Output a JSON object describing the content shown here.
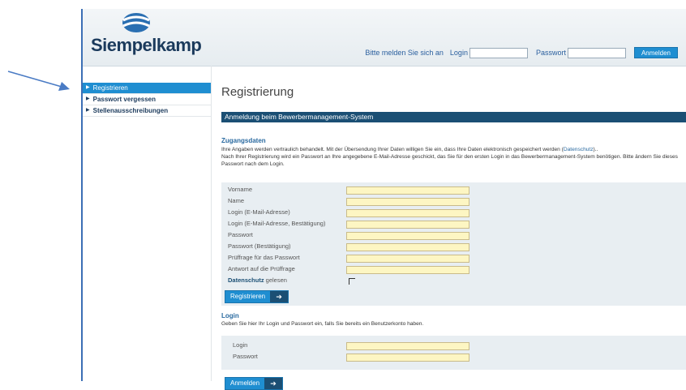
{
  "header": {
    "logo_text": "Siempelkamp",
    "login_prompt": "Bitte melden Sie sich an",
    "login_label": "Login",
    "password_label": "Passwort",
    "submit_label": "Anmelden"
  },
  "sidebar": {
    "items": [
      {
        "label": "Registrieren",
        "active": true
      },
      {
        "label": "Passwort vergessen",
        "active": false
      },
      {
        "label": "Stellenausschreibungen",
        "active": false
      }
    ]
  },
  "main": {
    "title": "Registrierung",
    "section_bar": "Anmeldung beim Bewerbermanagement-System",
    "access_heading": "Zugangsdaten",
    "intro_line1": "Ihre Angaben werden vertraulich behandelt. Mit der Übersendung Ihrer Daten willigen Sie ein, dass Ihre Daten elektronisch gespeichert werden (",
    "intro_link": "Datenschutz",
    "intro_line1_end": ")..",
    "intro_line2": "Nach Ihrer Registrierung wird ein Passwort an Ihre angegebene E-Mail-Adresse geschickt, das Sie für den ersten Login in das Bewerbermanagement-System benötigen. Bitte ändern Sie dieses Passwort nach dem Login.",
    "form": {
      "fields": [
        "Vorname",
        "Name",
        "Login (E-Mail-Adresse)",
        "Login (E-Mail-Adresse, Bestätigung)",
        "Passwort",
        "Passwort (Bestätigung)",
        "Prüffrage für das Passwort",
        "Antwort auf die Prüffrage"
      ],
      "privacy_link": "Datenschutz",
      "privacy_suffix": " gelesen",
      "register_button": "Registrieren"
    },
    "login": {
      "heading": "Login",
      "intro": "Geben Sie hier Ihr Login und Passwort ein, falls Sie bereits ein Benutzerkonto haben.",
      "login_label": "Login",
      "password_label": "Passwort",
      "submit_label": "Anmelden"
    }
  }
}
